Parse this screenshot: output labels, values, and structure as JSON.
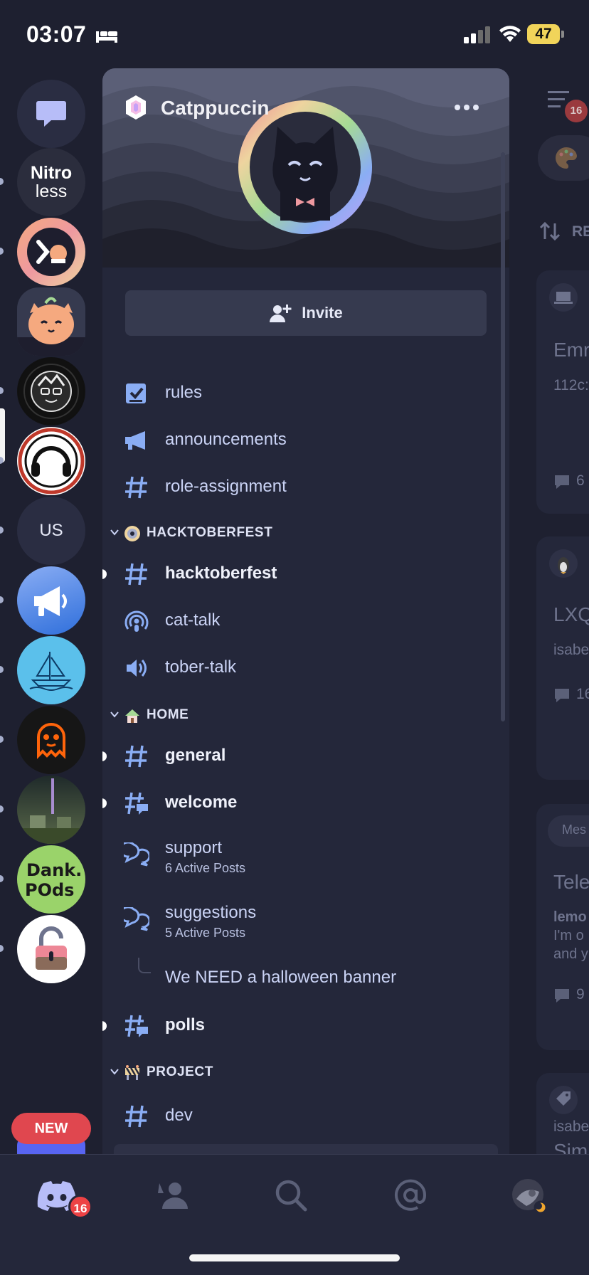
{
  "status_bar": {
    "time": "03:07",
    "battery": "47"
  },
  "server_rail": {
    "nitro_label_1": "Nitro",
    "nitro_label_2": "less",
    "us_label": "US",
    "new_label": "NEW"
  },
  "server": {
    "name": "Catppuccin",
    "invite_label": "Invite"
  },
  "channels": {
    "top": [
      {
        "name": "rules",
        "icon": "rules-checkbox-icon"
      },
      {
        "name": "announcements",
        "icon": "megaphone-icon"
      },
      {
        "name": "role-assignment",
        "icon": "hash-icon"
      }
    ],
    "hacktoberfest_category": "HACKTOBERFEST",
    "hacktoberfest": [
      {
        "name": "hacktoberfest",
        "icon": "hash-icon"
      },
      {
        "name": "cat-talk",
        "icon": "stage-icon"
      },
      {
        "name": "tober-talk",
        "icon": "voice-icon"
      }
    ],
    "home_category": "HOME",
    "home": [
      {
        "name": "general",
        "icon": "hash-icon"
      },
      {
        "name": "welcome",
        "icon": "hash-thread-icon"
      },
      {
        "name": "support",
        "sub": "6 Active Posts",
        "icon": "forum-icon"
      },
      {
        "name": "suggestions",
        "sub": "5 Active Posts",
        "icon": "forum-icon"
      },
      {
        "name": "We NEED a halloween banner",
        "icon": "thread-branch-icon"
      },
      {
        "name": "polls",
        "icon": "hash-thread-icon"
      }
    ],
    "project_category": "PROJECT",
    "project": [
      {
        "name": "dev",
        "icon": "hash-icon"
      }
    ]
  },
  "right_peek": {
    "sort_label": "RE",
    "card1_title": "Emr",
    "card1_sub": "112c:",
    "card1_count": "6",
    "card2_title": "LXQ",
    "card2_sub": "isabe",
    "card2_count": "16",
    "card3_tag": "Mes",
    "card3_title": "Tele",
    "card3_sub1": "lemo",
    "card3_sub2": "I'm o",
    "card3_sub3": "and y",
    "card3_count": "9",
    "card4_title": "Sim",
    "card4_sub": "isabe",
    "members_badge": "16"
  },
  "bottom_nav": {
    "home_badge": "16"
  },
  "colors": {
    "accent": "#8aadf4",
    "mauve": "#c6a0f6",
    "badge": "#ed4245",
    "panel": "#24273a",
    "base": "#1e2030"
  }
}
